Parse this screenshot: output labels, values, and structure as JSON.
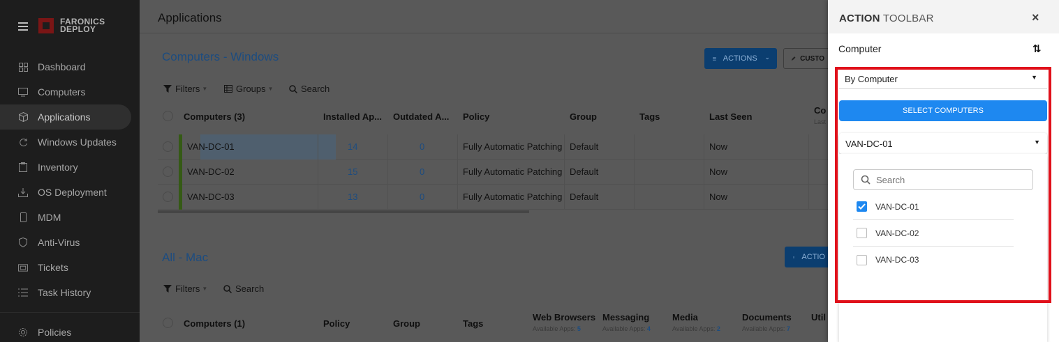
{
  "sidebar": {
    "logo_line1": "FARONICS",
    "logo_line2": "DEPLOY",
    "items": [
      {
        "label": "Dashboard",
        "icon": "dashboard-icon"
      },
      {
        "label": "Computers",
        "icon": "monitor-icon"
      },
      {
        "label": "Applications",
        "icon": "cube-icon",
        "active": true
      },
      {
        "label": "Windows Updates",
        "icon": "refresh-icon"
      },
      {
        "label": "Inventory",
        "icon": "clipboard-icon"
      },
      {
        "label": "OS Deployment",
        "icon": "deploy-icon"
      },
      {
        "label": "MDM",
        "icon": "phone-icon"
      },
      {
        "label": "Anti-Virus",
        "icon": "shield-icon"
      },
      {
        "label": "Tickets",
        "icon": "ticket-icon"
      },
      {
        "label": "Task History",
        "icon": "list-icon"
      }
    ],
    "policies_label": "Policies"
  },
  "header": {
    "title": "Applications"
  },
  "windows_section": {
    "title": "Computers - Windows",
    "actions_label": "ACTIONS",
    "customize_label": "CUSTO",
    "filters_label": "Filters",
    "groups_label": "Groups",
    "search_label": "Search",
    "columns": [
      "Computers (3)",
      "Installed Ap...",
      "Outdated A...",
      "Policy",
      "Group",
      "Tags",
      "Last Seen",
      "Co"
    ],
    "col_sub": "Last",
    "rows": [
      {
        "name": "VAN-DC-01",
        "installed": "14",
        "outdated": "0",
        "policy": "Fully Automatic Patching",
        "group": "Default",
        "tags": "",
        "last_seen": "Now"
      },
      {
        "name": "VAN-DC-02",
        "installed": "15",
        "outdated": "0",
        "policy": "Fully Automatic Patching",
        "group": "Default",
        "tags": "",
        "last_seen": "Now"
      },
      {
        "name": "VAN-DC-03",
        "installed": "13",
        "outdated": "0",
        "policy": "Fully Automatic Patching",
        "group": "Default",
        "tags": "",
        "last_seen": "Now"
      }
    ]
  },
  "mac_section": {
    "title": "All - Mac",
    "actions_label": "ACTIO",
    "filters_label": "Filters",
    "search_label": "Search",
    "columns": [
      "Computers (1)",
      "Policy",
      "Group",
      "Tags"
    ],
    "category_columns": [
      {
        "label": "Web Browsers",
        "sub": "Available Apps:",
        "count": "5"
      },
      {
        "label": "Messaging",
        "sub": "Available Apps:",
        "count": "4"
      },
      {
        "label": "Media",
        "sub": "Available Apps:",
        "count": "2"
      },
      {
        "label": "Documents",
        "sub": "Available Apps:",
        "count": "7"
      },
      {
        "label": "Util",
        "sub": "",
        "count": ""
      }
    ]
  },
  "panel": {
    "title_bold": "ACTION",
    "title_rest": "TOOLBAR",
    "close_label": "×",
    "computer_label": "Computer",
    "sort_label": "⇅",
    "by_select_value": "By Computer",
    "select_button_label": "SELECT COMPUTERS",
    "computer_select_value": "VAN-DC-01",
    "search_placeholder": "Search",
    "options": [
      {
        "label": "VAN-DC-01",
        "checked": true
      },
      {
        "label": "VAN-DC-02",
        "checked": false
      },
      {
        "label": "VAN-DC-03",
        "checked": false
      }
    ]
  },
  "colors": {
    "accent": "#1e88f0",
    "highlight_border": "#e0111b",
    "sidebar_bg": "#1d1d1d"
  }
}
